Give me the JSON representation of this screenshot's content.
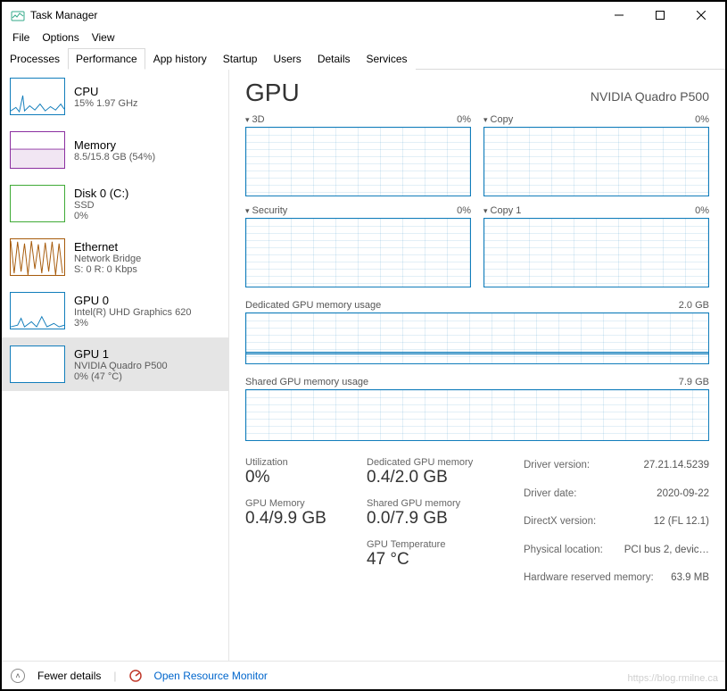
{
  "window": {
    "title": "Task Manager"
  },
  "menu": {
    "file": "File",
    "options": "Options",
    "view": "View"
  },
  "tabs": {
    "processes": "Processes",
    "performance": "Performance",
    "app_history": "App history",
    "startup": "Startup",
    "users": "Users",
    "details": "Details",
    "services": "Services"
  },
  "sidebar": {
    "cpu": {
      "title": "CPU",
      "sub": "15% 1.97 GHz"
    },
    "mem": {
      "title": "Memory",
      "sub": "8.5/15.8 GB (54%)"
    },
    "disk": {
      "title": "Disk 0 (C:)",
      "sub1": "SSD",
      "sub2": "0%"
    },
    "eth": {
      "title": "Ethernet",
      "sub1": "Network Bridge",
      "sub2": "S: 0 R: 0 Kbps"
    },
    "gpu0": {
      "title": "GPU 0",
      "sub1": "Intel(R) UHD Graphics 620",
      "sub2": "3%"
    },
    "gpu1": {
      "title": "GPU 1",
      "sub1": "NVIDIA Quadro P500",
      "sub2": "0%  (47 °C)"
    }
  },
  "main": {
    "title": "GPU",
    "device": "NVIDIA Quadro P500",
    "graphs": {
      "g1": {
        "name": "3D",
        "pct": "0%"
      },
      "g2": {
        "name": "Copy",
        "pct": "0%"
      },
      "g3": {
        "name": "Security",
        "pct": "0%"
      },
      "g4": {
        "name": "Copy 1",
        "pct": "0%"
      }
    },
    "dedicated": {
      "label": "Dedicated GPU memory usage",
      "max": "2.0 GB"
    },
    "shared": {
      "label": "Shared GPU memory usage",
      "max": "7.9 GB"
    },
    "stats": {
      "util_label": "Utilization",
      "util_value": "0%",
      "gpumem_label": "GPU Memory",
      "gpumem_value": "0.4/9.9 GB",
      "ded_label": "Dedicated GPU memory",
      "ded_value": "0.4/2.0 GB",
      "sh_label": "Shared GPU memory",
      "sh_value": "0.0/7.9 GB",
      "temp_label": "GPU Temperature",
      "temp_value": "47 °C"
    },
    "details": {
      "driver_version_k": "Driver version:",
      "driver_version_v": "27.21.14.5239",
      "driver_date_k": "Driver date:",
      "driver_date_v": "2020-09-22",
      "directx_k": "DirectX version:",
      "directx_v": "12 (FL 12.1)",
      "loc_k": "Physical location:",
      "loc_v": "PCI bus 2, devic…",
      "hwres_k": "Hardware reserved memory:",
      "hwres_v": "63.9 MB"
    }
  },
  "footer": {
    "fewer": "Fewer details",
    "resmon": "Open Resource Monitor"
  },
  "watermark": "https://blog.rmilne.ca",
  "chart_data": [
    {
      "type": "line",
      "title": "3D",
      "ylim": [
        0,
        100
      ],
      "values": [
        0
      ],
      "ylabel": "%"
    },
    {
      "type": "line",
      "title": "Copy",
      "ylim": [
        0,
        100
      ],
      "values": [
        0
      ],
      "ylabel": "%"
    },
    {
      "type": "line",
      "title": "Security",
      "ylim": [
        0,
        100
      ],
      "values": [
        0
      ],
      "ylabel": "%"
    },
    {
      "type": "line",
      "title": "Copy 1",
      "ylim": [
        0,
        100
      ],
      "values": [
        0
      ],
      "ylabel": "%"
    },
    {
      "type": "area",
      "title": "Dedicated GPU memory usage",
      "ylim": [
        0,
        2.0
      ],
      "values": [
        0.4
      ],
      "ylabel": "GB"
    },
    {
      "type": "area",
      "title": "Shared GPU memory usage",
      "ylim": [
        0,
        7.9
      ],
      "values": [
        0.0
      ],
      "ylabel": "GB"
    }
  ]
}
